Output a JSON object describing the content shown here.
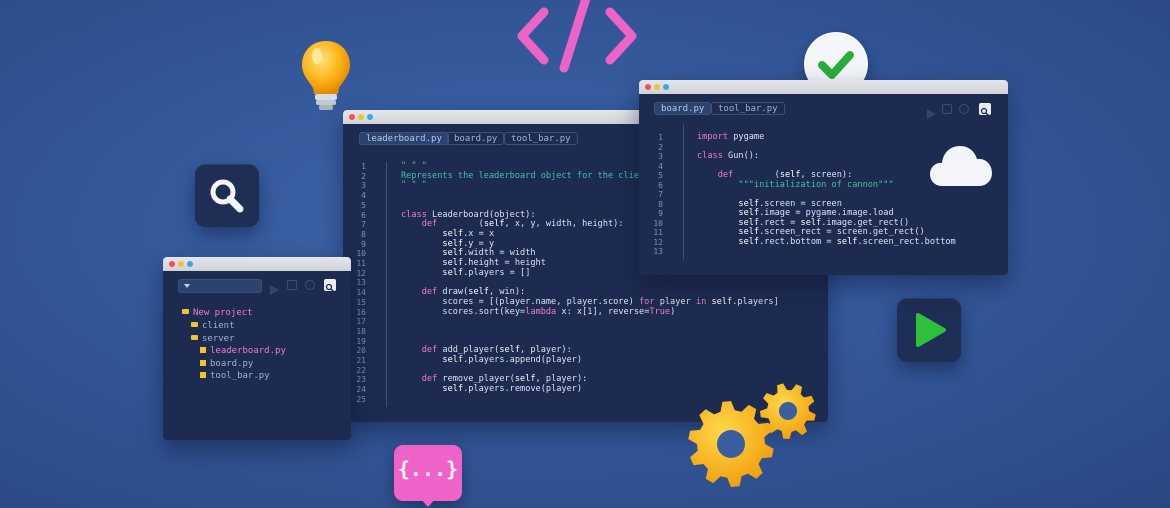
{
  "main_editor": {
    "tabs": [
      "leaderboard.py",
      "board.py",
      "tool_bar.py"
    ],
    "line_numbers": [
      "1",
      "2",
      "3",
      "4",
      "5",
      "6",
      "7",
      "8",
      "9",
      "10",
      "11",
      "12",
      "13",
      "14",
      "15",
      "16",
      "17",
      "18",
      "19",
      "20",
      "21",
      "22",
      "23",
      "24",
      "25"
    ],
    "lines": [
      "\" \" \"",
      "Represents the leaderboard object for the clie",
      "\" \" \"",
      "",
      "",
      "class Leaderboard(object):",
      "    def        (self, x, y, width, height):",
      "        self.x = x",
      "        self.y = y",
      "        self.width = width",
      "        self.height = height",
      "        self.players = []",
      "",
      "    def draw(self, win):",
      "        scores = [(player.name, player.score) for player in self.players]",
      "        scores.sort(key=lambda x: x[1], reverse=True)",
      "",
      "",
      "",
      "    def add_player(self, player):",
      "        self.players.append(player)",
      "",
      "    def remove_player(self, player):",
      "        self.players.remove(player)",
      ""
    ]
  },
  "right_editor": {
    "tabs": [
      "board.py",
      "tool_bar.py"
    ],
    "line_numbers": [
      "1",
      "2",
      "3",
      "4",
      "5",
      "6",
      "7",
      "8",
      "9",
      "10",
      "11",
      "12",
      "13"
    ],
    "lines": [
      "import pygame",
      "",
      "class Gun():",
      "",
      "    def        (self, screen):",
      "        \"\"\"initialization of cannon\"\"\"",
      "",
      "        self.screen = screen",
      "        self.image = pygame.image.load",
      "        self.rect = self.image.get_rect()",
      "        self.screen_rect = screen.get_rect()",
      "        self.rect.bottom = self.screen_rect.bottom",
      ""
    ]
  },
  "explorer": {
    "items": [
      "New project",
      "client",
      "server",
      "leaderboard.py",
      "board.py",
      "tool_bar.py"
    ]
  },
  "floating_icons": {
    "code_tag": "</>",
    "braces": "{...}"
  },
  "colors": {
    "background": "#34589a",
    "editor": "#1d2b50",
    "accent_pink": "#f07cc6",
    "accent_green": "#2fbf3a",
    "accent_yellow": "#f2b51f"
  }
}
